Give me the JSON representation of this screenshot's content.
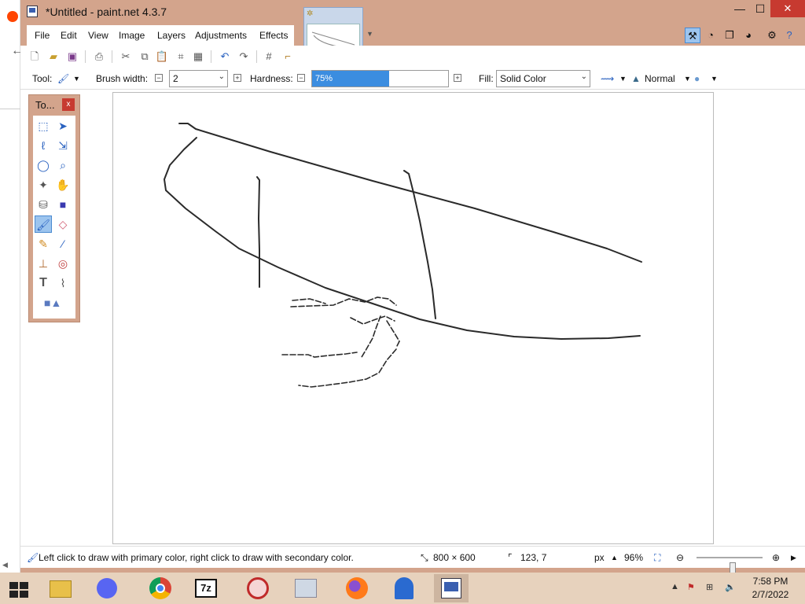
{
  "window": {
    "title": "*Untitled - paint.net 4.3.7",
    "minimize": "—",
    "maximize": "☐",
    "close": "✕"
  },
  "menu": [
    "File",
    "Edit",
    "View",
    "Image",
    "Layers",
    "Adjustments",
    "Effects"
  ],
  "options": {
    "tool_label": "Tool:",
    "brush_width_label": "Brush width:",
    "brush_width_value": "2",
    "hardness_label": "Hardness:",
    "hardness_value": "75%",
    "hardness_percent": 75,
    "fill_label": "Fill:",
    "fill_value": "Solid Color",
    "blend_mode": "Normal"
  },
  "tools_panel": {
    "title": "To...",
    "close": "x"
  },
  "status": {
    "hint": "Left click to draw with primary color, right click to draw with secondary color.",
    "image_size": "800 × 600",
    "cursor_pos": "123, 7",
    "units": "px",
    "zoom": "96%",
    "zoom_fraction": 0.55
  },
  "taskbar": {
    "time": "7:58 PM",
    "date": "2/7/2022"
  },
  "colors": {
    "accent": "#3b8de0",
    "title_bg": "#d3a48c",
    "close_red": "#c73a30",
    "taskbar": "#e7d2bd"
  },
  "icons": {
    "file_menu": "new-image-icon",
    "tools": [
      "rectangle-select-icon",
      "move-selection-icon",
      "lasso-select-icon",
      "move-selected-icon",
      "ellipse-select-icon",
      "zoom-icon",
      "magic-wand-icon",
      "pan-icon",
      "paint-bucket-icon",
      "gradient-icon",
      "paintbrush-icon",
      "eraser-icon",
      "pencil-icon",
      "color-picker-icon",
      "clone-stamp-icon",
      "recolor-icon",
      "text-icon",
      "line-curve-icon",
      "shapes-icon"
    ]
  }
}
